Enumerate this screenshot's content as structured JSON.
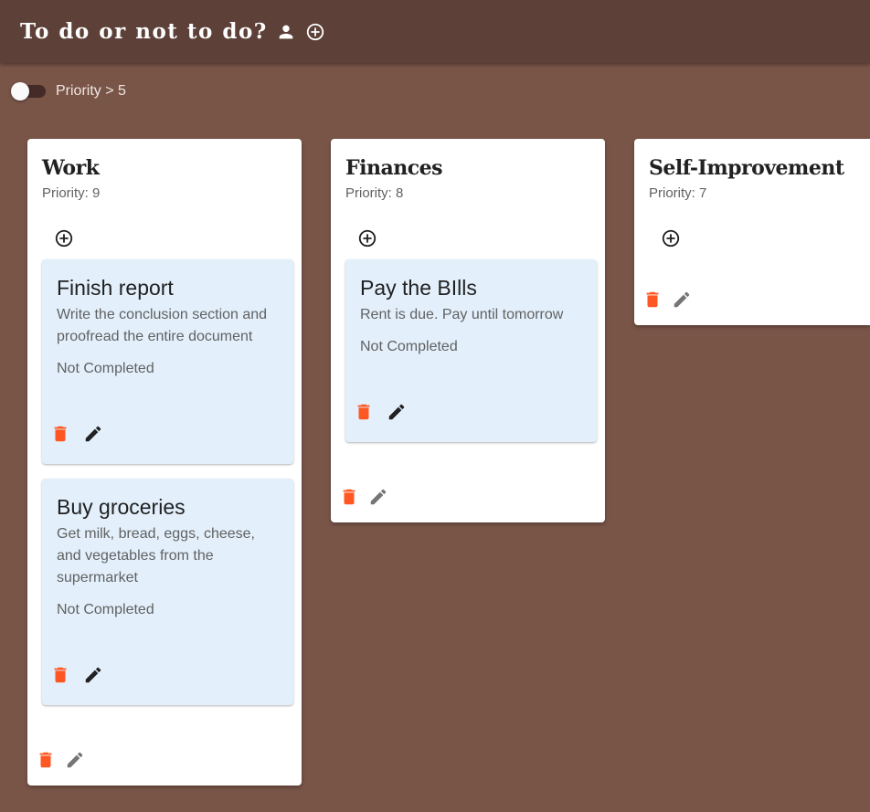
{
  "header": {
    "title": "To do or not to do?",
    "icons": [
      "person-icon",
      "add-circle-icon"
    ]
  },
  "filter": {
    "label": "Priority > 5",
    "enabled": false
  },
  "colors": {
    "background": "#795548",
    "appbar": "#5d4037",
    "task_card": "#e3f0fc",
    "delete": "#ff5722",
    "edit_task": "#212121",
    "edit_column": "#757575"
  },
  "columns": [
    {
      "title": "Work",
      "priority": "Priority: 9",
      "tasks": [
        {
          "title": "Finish report",
          "description": "Write the conclusion section and proofread the entire document",
          "status": "Not Completed"
        },
        {
          "title": "Buy groceries",
          "description": "Get milk, bread, eggs, cheese, and vegetables from the supermarket",
          "status": "Not Completed"
        }
      ]
    },
    {
      "title": "Finances",
      "priority": "Priority: 8",
      "tasks": [
        {
          "title": "Pay the BIlls",
          "description": "Rent is due. Pay until tomorrow",
          "status": "Not Completed"
        }
      ]
    },
    {
      "title": "Self-Improvement",
      "priority": "Priority: 7",
      "tasks": []
    }
  ]
}
